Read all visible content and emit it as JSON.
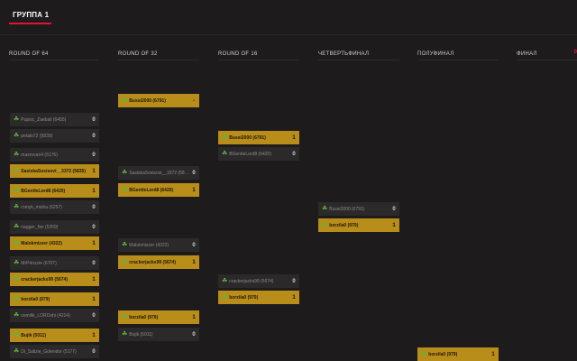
{
  "group_tab": "ГРУППА 1",
  "rounds": [
    "ROUND OF 64",
    "ROUND OF 32",
    "ROUND OF 16",
    "ЧЕТВЕРТЬФИНАЛ",
    "ПОЛУФИНАЛ",
    "ФИНАЛ"
  ],
  "badge": "0",
  "slots": [
    {
      "name": "Pupsic_Zaebali (6455)",
      "score": "0",
      "win": false
    },
    {
      "name": "petalo72 (5839)",
      "score": "0",
      "win": false
    },
    {
      "name": "maxrovan4 (6176)",
      "score": "0",
      "win": false
    },
    {
      "name": "SasiskaSosisovi__3372 (5835)",
      "score": "1",
      "win": true
    },
    {
      "name": "BGentleLord8 (6420)",
      "score": "1",
      "win": true
    },
    {
      "name": "romyk_misha (6257)",
      "score": "0",
      "win": false
    },
    {
      "name": "nagger_fan (5359)",
      "score": "0",
      "win": false
    },
    {
      "name": "Malokmizzer (4322)",
      "score": "1",
      "win": true
    },
    {
      "name": "MrPrinzzie (6707)",
      "score": "0",
      "win": false
    },
    {
      "name": "crackerjacks99 (5674)",
      "score": "1",
      "win": true
    },
    {
      "name": "borzila0 (979)",
      "score": "1",
      "win": true
    },
    {
      "name": "osmilik_LOROshi (4214)",
      "score": "0",
      "win": false
    },
    {
      "name": "Bujik (5011)",
      "score": "1",
      "win": true
    },
    {
      "name": "Di_Salizie_Golendor (5177)",
      "score": "0",
      "win": false
    },
    {
      "name": "Bussi2000 (6791)",
      "score": "-",
      "win": true
    },
    {
      "name": "SasiskaSosisovi__3372 (5835)",
      "score": "0",
      "win": false
    },
    {
      "name": "BGentleLord8 (6420)",
      "score": "1",
      "win": true
    },
    {
      "name": "Malokmizzer (4322)",
      "score": "0",
      "win": false
    },
    {
      "name": "crackerjacks99 (5674)",
      "score": "1",
      "win": true
    },
    {
      "name": "borzila0 (979)",
      "score": "1",
      "win": true
    },
    {
      "name": "Bujik (5011)",
      "score": "0",
      "win": false
    },
    {
      "name": "Bussi2000 (6791)",
      "score": "1",
      "win": true
    },
    {
      "name": "BGentleLord8 (6420)",
      "score": "0",
      "win": false
    },
    {
      "name": "crackerjacks99 (5674)",
      "score": "0",
      "win": false
    },
    {
      "name": "borzila0 (979)",
      "score": "1",
      "win": true
    },
    {
      "name": "Bussi2000 (6791)",
      "score": "0",
      "win": false
    },
    {
      "name": "borzila0 (979)",
      "score": "1",
      "win": true
    },
    {
      "name": "borzila0 (979)",
      "score": "1",
      "win": true
    }
  ]
}
